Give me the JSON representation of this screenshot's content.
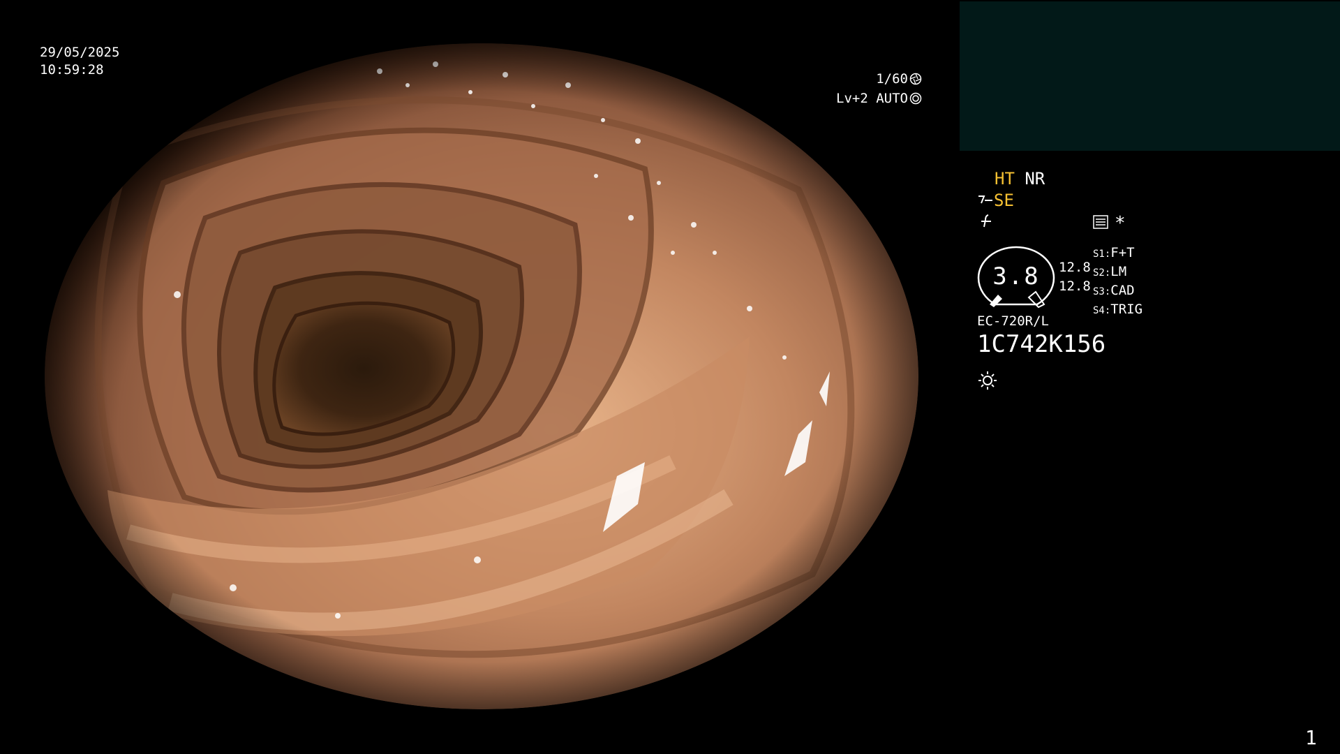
{
  "overlay": {
    "date": "29/05/2025",
    "time": "10:59:28",
    "shutter_speed": "1/60",
    "level": "Lv+2",
    "exposure_mode": "AUTO"
  },
  "panel": {
    "mode_ht": "HT",
    "mode_nr": "NR",
    "mode_se": "SE",
    "dial_value": "3.8",
    "dial_reading_1": "12.8",
    "dial_reading_2": "12.8",
    "slots": [
      {
        "key": "S1",
        "label": "F+T"
      },
      {
        "key": "S2",
        "label": "LM"
      },
      {
        "key": "S3",
        "label": "CAD"
      },
      {
        "key": "S4",
        "label": "TRIG"
      }
    ],
    "star": "*",
    "scope_model": "EC-720R/L",
    "scope_serial": "1C742K156",
    "page_number": "1"
  },
  "colors": {
    "background": "#000000",
    "preview_box": "#021918",
    "highlight": "#f6c132",
    "text": "#ffffff",
    "mucosa": "#b07556"
  },
  "icons": {
    "shutter_icon": "aperture-icon",
    "auto_icon": "iris-icon",
    "scope_icon": "scope-angle-icon",
    "freeze_icon": "slash-f-icon",
    "menu_icon": "menu-list-icon",
    "light_icon": "sun-icon"
  }
}
